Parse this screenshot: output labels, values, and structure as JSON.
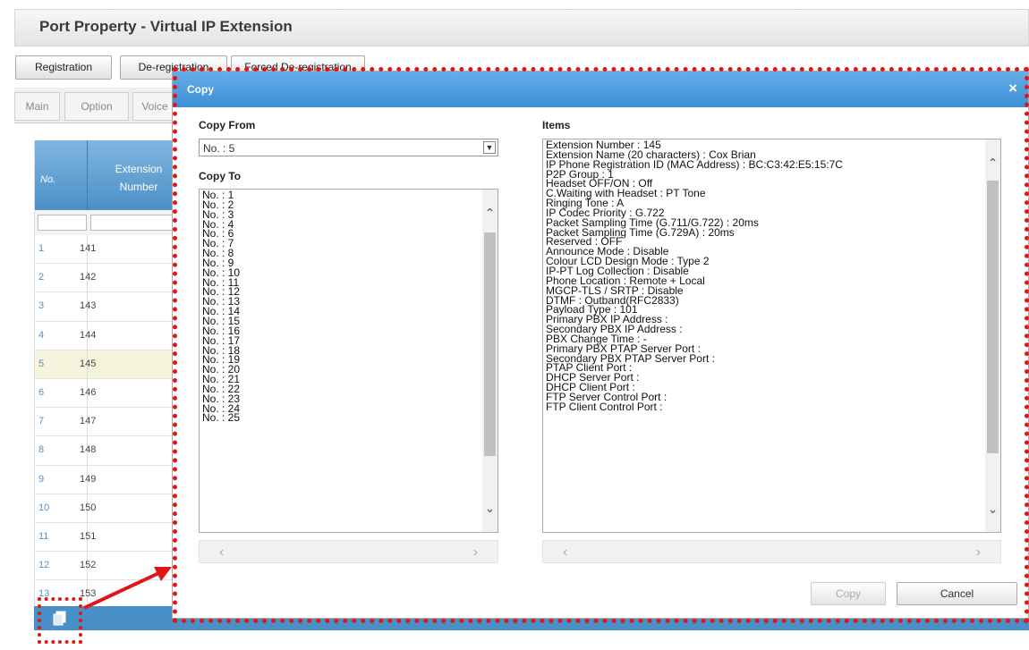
{
  "page": {
    "title": "Port Property - Virtual IP Extension",
    "buttons": [
      "Registration",
      "De-registration",
      "Forced De-registration"
    ],
    "tabs": [
      "Main",
      "Option",
      "Voice"
    ]
  },
  "grid": {
    "col_no": "No.",
    "col_ext": "Extension Number",
    "rows": [
      {
        "no": "1",
        "ext": "141"
      },
      {
        "no": "2",
        "ext": "142"
      },
      {
        "no": "3",
        "ext": "143"
      },
      {
        "no": "4",
        "ext": "144"
      },
      {
        "no": "5",
        "ext": "145"
      },
      {
        "no": "6",
        "ext": "146"
      },
      {
        "no": "7",
        "ext": "147"
      },
      {
        "no": "8",
        "ext": "148"
      },
      {
        "no": "9",
        "ext": "149"
      },
      {
        "no": "10",
        "ext": "150"
      },
      {
        "no": "11",
        "ext": "151"
      },
      {
        "no": "12",
        "ext": "152"
      },
      {
        "no": "13",
        "ext": "153"
      }
    ],
    "selected_row_index": 4
  },
  "dialog": {
    "title": "Copy",
    "close_glyph": "×",
    "copy_from_label": "Copy From",
    "copy_from_value": "No. : 5",
    "copy_to_label": "Copy To",
    "items_label": "Items",
    "copy_to_list": [
      "No. : 1",
      "No. : 2",
      "No. : 3",
      "No. : 4",
      "No. : 6",
      "No. : 7",
      "No. : 8",
      "No. : 9",
      "No. : 10",
      "No. : 11",
      "No. : 12",
      "No. : 13",
      "No. : 14",
      "No. : 15",
      "No. : 16",
      "No. : 17",
      "No. : 18",
      "No. : 19",
      "No. : 20",
      "No. : 21",
      "No. : 22",
      "No. : 23",
      "No. : 24",
      "No. : 25"
    ],
    "items_list": [
      "Extension Number : 145",
      "Extension Name (20 characters) : Cox Brian",
      "IP Phone Registration ID (MAC Address) : BC:C3:42:E5:15:7C",
      "P2P Group : 1",
      "Headset OFF/ON : Off",
      "C.Waiting with Headset : PT Tone",
      "Ringing Tone : A",
      "IP Codec Priority : G.722",
      "Packet Sampling Time (G.711/G.722) : 20ms",
      "Packet Sampling Time (G.729A) : 20ms",
      "Reserved : OFF",
      "Announce Mode : Disable",
      "Colour LCD Design Mode : Type 2",
      "IP-PT Log Collection : Disable",
      "Phone Location : Remote + Local",
      "MGCP-TLS / SRTP : Disable",
      "DTMF : Outband(RFC2833)",
      "Payload Type : 101",
      "Primary PBX IP Address :",
      "Secondary PBX IP Address :",
      "PBX Change Time : -",
      "Primary PBX PTAP Server Port :",
      "Secondary PBX PTAP Server Port :",
      "PTAP Client Port :",
      "DHCP Server Port :",
      "DHCP Client Port :",
      "FTP Server Control Port :",
      "FTP Client Control Port :"
    ],
    "copy_button": "Copy",
    "cancel_button": "Cancel"
  },
  "colors": {
    "accent_blue": "#4a90c8",
    "highlight_red": "#e01616",
    "selected_row": "#f6f4dc"
  }
}
